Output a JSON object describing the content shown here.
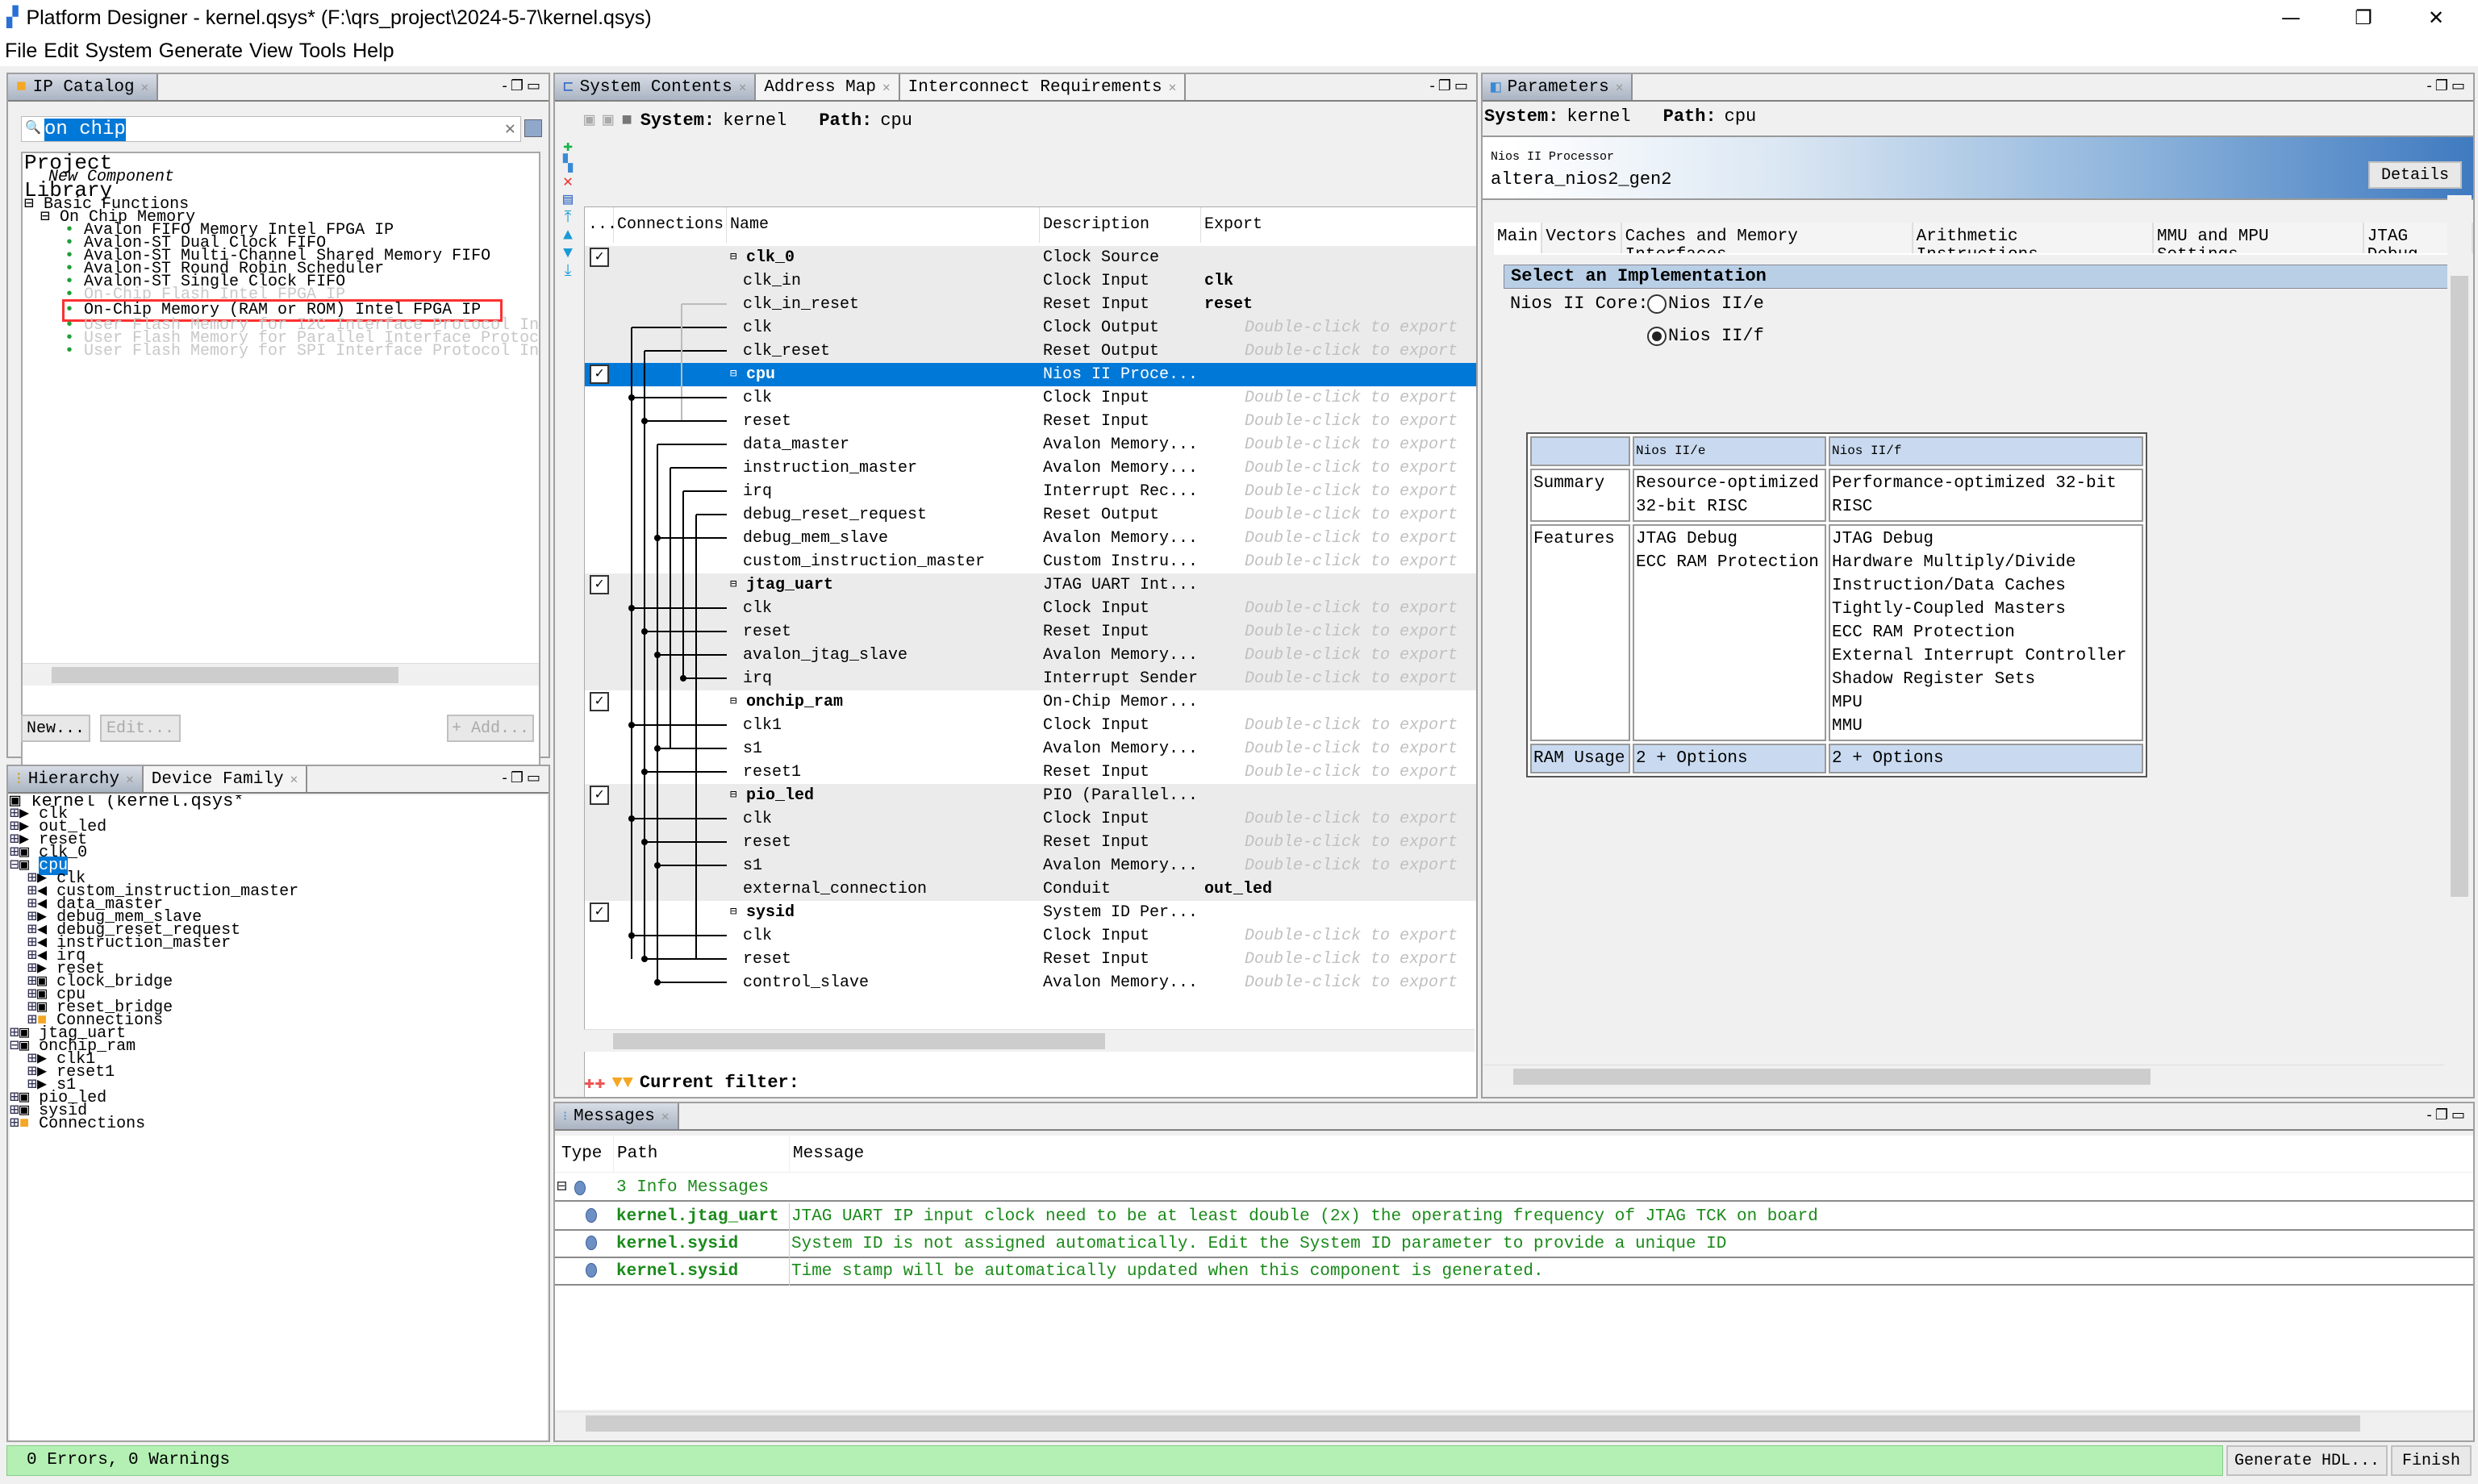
{
  "window": {
    "title": "Platform Designer - kernel.qsys* (F:\\qrs_project\\2024-5-7\\kernel.qsys)",
    "minimize": "—",
    "restore": "❐",
    "close": "✕"
  },
  "menu": [
    "File",
    "Edit",
    "System",
    "Generate",
    "View",
    "Tools",
    "Help"
  ],
  "ip_catalog": {
    "tab": "IP Catalog",
    "search_value": "on chip",
    "project_label": "Project",
    "new_component": "New Component",
    "library_label": "Library",
    "basic_functions": "Basic Functions",
    "on_chip_memory": "On Chip Memory",
    "items": [
      {
        "label": "Avalon FIFO Memory Intel FPGA IP",
        "enabled": true
      },
      {
        "label": "Avalon-ST Dual Clock FIFO",
        "enabled": true
      },
      {
        "label": "Avalon-ST Multi-Channel Shared Memory FIFO",
        "enabled": true
      },
      {
        "label": "Avalon-ST Round Robin Scheduler",
        "enabled": true
      },
      {
        "label": "Avalon-ST Single Clock FIFO",
        "enabled": true
      },
      {
        "label": "On-Chip Flash Intel FPGA IP",
        "enabled": false
      },
      {
        "label": "On-Chip Memory (RAM or ROM) Intel FPGA IP",
        "enabled": true,
        "highlighted": true
      },
      {
        "label": "User Flash Memory for I2C Interface Protocol Intel FPGA IP",
        "enabled": false
      },
      {
        "label": "User Flash Memory for Parallel Interface Protocol Intel FPGA IP",
        "enabled": false
      },
      {
        "label": "User Flash Memory for SPI Interface Protocol Intel FPGA IP",
        "enabled": false
      }
    ],
    "buttons": {
      "new": "New...",
      "edit": "Edit...",
      "add": "+ Add..."
    },
    "highlight_color": "#ff3030"
  },
  "hierarchy": {
    "tabs": [
      "Hierarchy",
      "Device Family"
    ],
    "root": "kernel (kernel.qsys*",
    "items": [
      {
        "label": "clk",
        "level": 0,
        "icon": "export-in",
        "exp": "+"
      },
      {
        "label": "out_led",
        "level": 0,
        "icon": "export-in",
        "exp": "+"
      },
      {
        "label": "reset",
        "level": 0,
        "icon": "export-in",
        "exp": "+"
      },
      {
        "label": "clk_0",
        "level": 0,
        "icon": "module",
        "exp": "+"
      },
      {
        "label": "cpu",
        "level": 0,
        "icon": "system",
        "exp": "-",
        "selected": true
      },
      {
        "label": "clk",
        "level": 1,
        "icon": "in",
        "exp": "+"
      },
      {
        "label": "custom_instruction_master",
        "level": 1,
        "icon": "out",
        "exp": "+"
      },
      {
        "label": "data_master",
        "level": 1,
        "icon": "out",
        "exp": "+"
      },
      {
        "label": "debug_mem_slave",
        "level": 1,
        "icon": "in",
        "exp": "+"
      },
      {
        "label": "debug_reset_request",
        "level": 1,
        "icon": "out",
        "exp": "+"
      },
      {
        "label": "instruction_master",
        "level": 1,
        "icon": "out",
        "exp": "+"
      },
      {
        "label": "irq",
        "level": 1,
        "icon": "out",
        "exp": "+"
      },
      {
        "label": "reset",
        "level": 1,
        "icon": "in",
        "exp": "+"
      },
      {
        "label": "clock_bridge",
        "level": 1,
        "icon": "module",
        "exp": "+"
      },
      {
        "label": "cpu",
        "level": 1,
        "icon": "module",
        "exp": "+"
      },
      {
        "label": "reset_bridge",
        "level": 1,
        "icon": "module",
        "exp": "+"
      },
      {
        "label": "Connections",
        "level": 1,
        "icon": "folder",
        "exp": "+"
      },
      {
        "label": "jtag_uart",
        "level": 0,
        "icon": "module",
        "exp": "+"
      },
      {
        "label": "onchip_ram",
        "level": 0,
        "icon": "module",
        "exp": "-"
      },
      {
        "label": "clk1",
        "level": 1,
        "icon": "in",
        "exp": "+"
      },
      {
        "label": "reset1",
        "level": 1,
        "icon": "in",
        "exp": "+"
      },
      {
        "label": "s1",
        "level": 1,
        "icon": "in",
        "exp": "+"
      },
      {
        "label": "pio_led",
        "level": 0,
        "icon": "module",
        "exp": "+"
      },
      {
        "label": "sysid",
        "level": 0,
        "icon": "module",
        "exp": "+"
      },
      {
        "label": "Connections",
        "level": 0,
        "icon": "folder",
        "exp": "+"
      }
    ]
  },
  "system_contents": {
    "tabs": [
      "System Contents",
      "Address Map",
      "Interconnect Requirements"
    ],
    "system_label": "System:",
    "system_value": "kernel",
    "path_label": "Path:",
    "path_value": "cpu",
    "columns": [
      "...",
      "Connections",
      "Name",
      "Description",
      "Export"
    ],
    "export_hint": "Double-click to export",
    "rows": [
      {
        "name": "clk_0",
        "desc": "Clock Source",
        "export": "",
        "component": true,
        "checked": true
      },
      {
        "name": "clk_in",
        "desc": "Clock Input",
        "export": "clk"
      },
      {
        "name": "clk_in_reset",
        "desc": "Reset Input",
        "export": "reset"
      },
      {
        "name": "clk",
        "desc": "Clock Output",
        "export": null
      },
      {
        "name": "clk_reset",
        "desc": "Reset Output",
        "export": null
      },
      {
        "name": "cpu",
        "desc": "Nios II Proce...",
        "export": "",
        "component": true,
        "checked": true,
        "selected": true
      },
      {
        "name": "clk",
        "desc": "Clock Input",
        "export": null
      },
      {
        "name": "reset",
        "desc": "Reset Input",
        "export": null
      },
      {
        "name": "data_master",
        "desc": "Avalon Memory...",
        "export": null
      },
      {
        "name": "instruction_master",
        "desc": "Avalon Memory...",
        "export": null
      },
      {
        "name": "irq",
        "desc": "Interrupt Rec...",
        "export": null
      },
      {
        "name": "debug_reset_request",
        "desc": "Reset Output",
        "export": null
      },
      {
        "name": "debug_mem_slave",
        "desc": "Avalon Memory...",
        "export": null
      },
      {
        "name": "custom_instruction_master",
        "desc": "Custom Instru...",
        "export": null
      },
      {
        "name": "jtag_uart",
        "desc": "JTAG UART Int...",
        "export": "",
        "component": true,
        "checked": true
      },
      {
        "name": "clk",
        "desc": "Clock Input",
        "export": null
      },
      {
        "name": "reset",
        "desc": "Reset Input",
        "export": null
      },
      {
        "name": "avalon_jtag_slave",
        "desc": "Avalon Memory...",
        "export": null
      },
      {
        "name": "irq",
        "desc": "Interrupt Sender",
        "export": null
      },
      {
        "name": "onchip_ram",
        "desc": "On-Chip Memor...",
        "export": "",
        "component": true,
        "checked": true
      },
      {
        "name": "clk1",
        "desc": "Clock Input",
        "export": null
      },
      {
        "name": "s1",
        "desc": "Avalon Memory...",
        "export": null
      },
      {
        "name": "reset1",
        "desc": "Reset Input",
        "export": null
      },
      {
        "name": "pio_led",
        "desc": "PIO (Parallel...",
        "export": "",
        "component": true,
        "checked": true
      },
      {
        "name": "clk",
        "desc": "Clock Input",
        "export": null
      },
      {
        "name": "reset",
        "desc": "Reset Input",
        "export": null
      },
      {
        "name": "s1",
        "desc": "Avalon Memory...",
        "export": null
      },
      {
        "name": "external_connection",
        "desc": "Conduit",
        "export": "out_led"
      },
      {
        "name": "sysid",
        "desc": "System ID Per...",
        "export": "",
        "component": true,
        "checked": true
      },
      {
        "name": "clk",
        "desc": "Clock Input",
        "export": null
      },
      {
        "name": "reset",
        "desc": "Reset Input",
        "export": null
      },
      {
        "name": "control_slave",
        "desc": "Avalon Memory...",
        "export": null
      }
    ],
    "filter_label": "Current filter:",
    "selection_color": "#0078d7"
  },
  "parameters": {
    "tab": "Parameters",
    "system_label": "System:",
    "system_value": "kernel",
    "path_label": "Path:",
    "path_value": "cpu",
    "component_type": "Nios II Processor",
    "component_name": "altera_nios2_gen2",
    "details_button": "Details",
    "tabs": [
      "Main",
      "Vectors",
      "Caches and Memory Interfaces",
      "Arithmetic Instructions",
      "MMU and MPU Settings",
      "JTAG Debug"
    ],
    "section": "Select an Implementation",
    "core_label": "Nios II Core:",
    "core_options": [
      {
        "label": "Nios II/e",
        "selected": false
      },
      {
        "label": "Nios II/f",
        "selected": true
      }
    ],
    "table": {
      "header": [
        "",
        "Nios II/e",
        "Nios II/f"
      ],
      "summary": [
        "Summary",
        "Resource-optimized 32-bit RISC",
        "Performance-optimized 32-bit RISC"
      ],
      "features_label": "Features",
      "features_e": [
        "JTAG Debug",
        "ECC RAM Protection"
      ],
      "features_f": [
        "JTAG Debug",
        "Hardware Multiply/Divide",
        "Instruction/Data Caches",
        "Tightly-Coupled Masters",
        "ECC RAM Protection",
        "External Interrupt Controller",
        "Shadow Register Sets",
        "MPU",
        "MMU"
      ],
      "ram_usage": [
        "RAM Usage",
        "2 + Options",
        "2 + Options"
      ]
    }
  },
  "messages": {
    "tab": "Messages",
    "columns": [
      "Type",
      "Path",
      "Message"
    ],
    "group": "3 Info Messages",
    "items": [
      {
        "path": "kernel.jtag_uart",
        "message": "JTAG UART IP input clock need to be at least double (2x) the operating frequency of JTAG TCK on board"
      },
      {
        "path": "kernel.sysid",
        "message": "System ID is not assigned automatically. Edit the System ID parameter to provide a unique ID"
      },
      {
        "path": "kernel.sysid",
        "message": "Time stamp will be automatically updated when this component is generated."
      }
    ],
    "text_color": "#1a8a1a"
  },
  "status": {
    "text": "0 Errors, 0 Warnings",
    "generate_button": "Generate HDL...",
    "finish_button": "Finish",
    "ok_color": "#b4f0b4"
  }
}
